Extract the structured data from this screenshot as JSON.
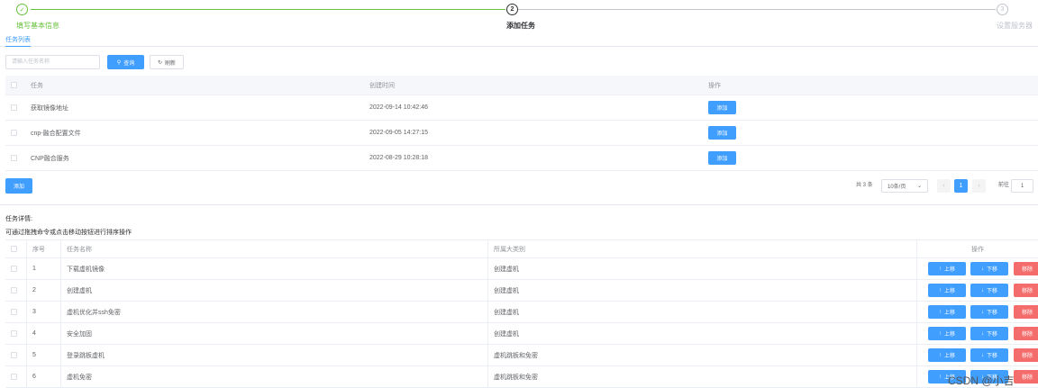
{
  "steps": [
    {
      "title": "填写基本信息",
      "icon": "✓",
      "status": "done"
    },
    {
      "title": "添加任务",
      "icon": "2",
      "status": "active"
    },
    {
      "title": "设置服务器",
      "icon": "3",
      "status": "wait"
    }
  ],
  "tabs": {
    "task_list": "任务列表"
  },
  "toolbar": {
    "search_placeholder": "请输入任务名称",
    "query_label": "查询",
    "refresh_label": "刷新"
  },
  "task_table": {
    "headers": {
      "task": "任务",
      "created": "创建时间",
      "op": "操作"
    },
    "rows": [
      {
        "name": "获取镜像地址",
        "time": "2022-09-14 10:42:46",
        "action": "添加"
      },
      {
        "name": "cnp-融合配置文件",
        "time": "2022-09-05 14:27:15",
        "action": "添加"
      },
      {
        "name": "CNP融合服务",
        "time": "2022-08-29 10:28:18",
        "action": "添加"
      }
    ]
  },
  "add_button": "添加",
  "pagination": {
    "total": "共 3 条",
    "page_size": "10条/页",
    "current_page": "1",
    "goto_label": "前往",
    "goto_value": "1"
  },
  "details": {
    "title": "任务详情:",
    "hint": "可通过拖拽命令或点击移动按钮进行排序操作",
    "headers": {
      "index": "序号",
      "name": "任务名称",
      "group": "所属大类别",
      "op": "操作"
    },
    "up_label": "上移",
    "down_label": "下移",
    "remove_label": "移除",
    "rows": [
      {
        "index": "1",
        "name": "下载虚机镜像",
        "group": "创建虚机"
      },
      {
        "index": "2",
        "name": "创建虚机",
        "group": "创建虚机"
      },
      {
        "index": "3",
        "name": "虚机优化并ssh免密",
        "group": "创建虚机"
      },
      {
        "index": "4",
        "name": "安全加固",
        "group": "创建虚机"
      },
      {
        "index": "5",
        "name": "登录跳板虚机",
        "group": "虚机跳板和免密"
      },
      {
        "index": "6",
        "name": "虚机免密",
        "group": "虚机跳板和免密"
      }
    ]
  },
  "watermark": "CSDN @小吉"
}
